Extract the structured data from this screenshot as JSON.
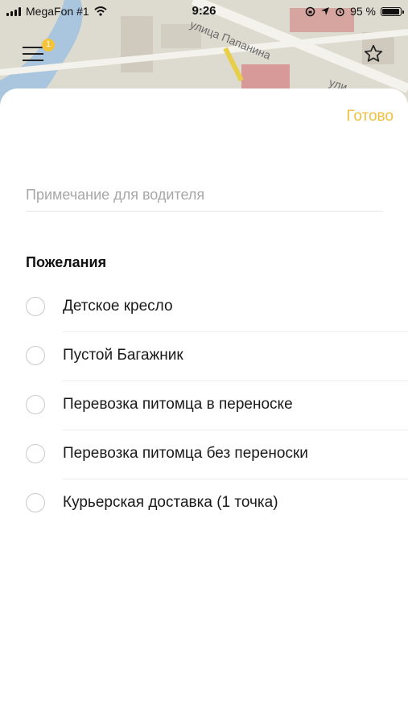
{
  "status_bar": {
    "carrier": "MegaFon #1",
    "time": "9:26",
    "battery": "95 %",
    "battery_level": 0.95,
    "icons": [
      "signal-icon",
      "wifi-icon",
      "rotation-lock-icon",
      "location-arrow-icon",
      "alarm-icon",
      "battery-icon"
    ]
  },
  "map": {
    "street_1": "улица Папанина",
    "street_2": "ули"
  },
  "header": {
    "menu_icon": "menu-icon",
    "notification_count": "1",
    "favorite_icon": "star-icon"
  },
  "sheet": {
    "done_label": "Готово",
    "note": {
      "placeholder": "Примечание для водителя",
      "value": ""
    },
    "wishes_title": "Пожелания",
    "options": [
      {
        "label": "Детское кресло",
        "checked": false
      },
      {
        "label": "Пустой Багажник",
        "checked": false
      },
      {
        "label": "Перевозка питомца в переноске",
        "checked": false
      },
      {
        "label": "Перевозка питомца без переноски",
        "checked": false
      },
      {
        "label": "Курьерская доставка (1 точка)",
        "checked": false
      }
    ]
  },
  "colors": {
    "accent": "#f0c040",
    "badge": "#f3c33b",
    "text": "#1a1a1a",
    "placeholder": "#a7a7a7"
  }
}
